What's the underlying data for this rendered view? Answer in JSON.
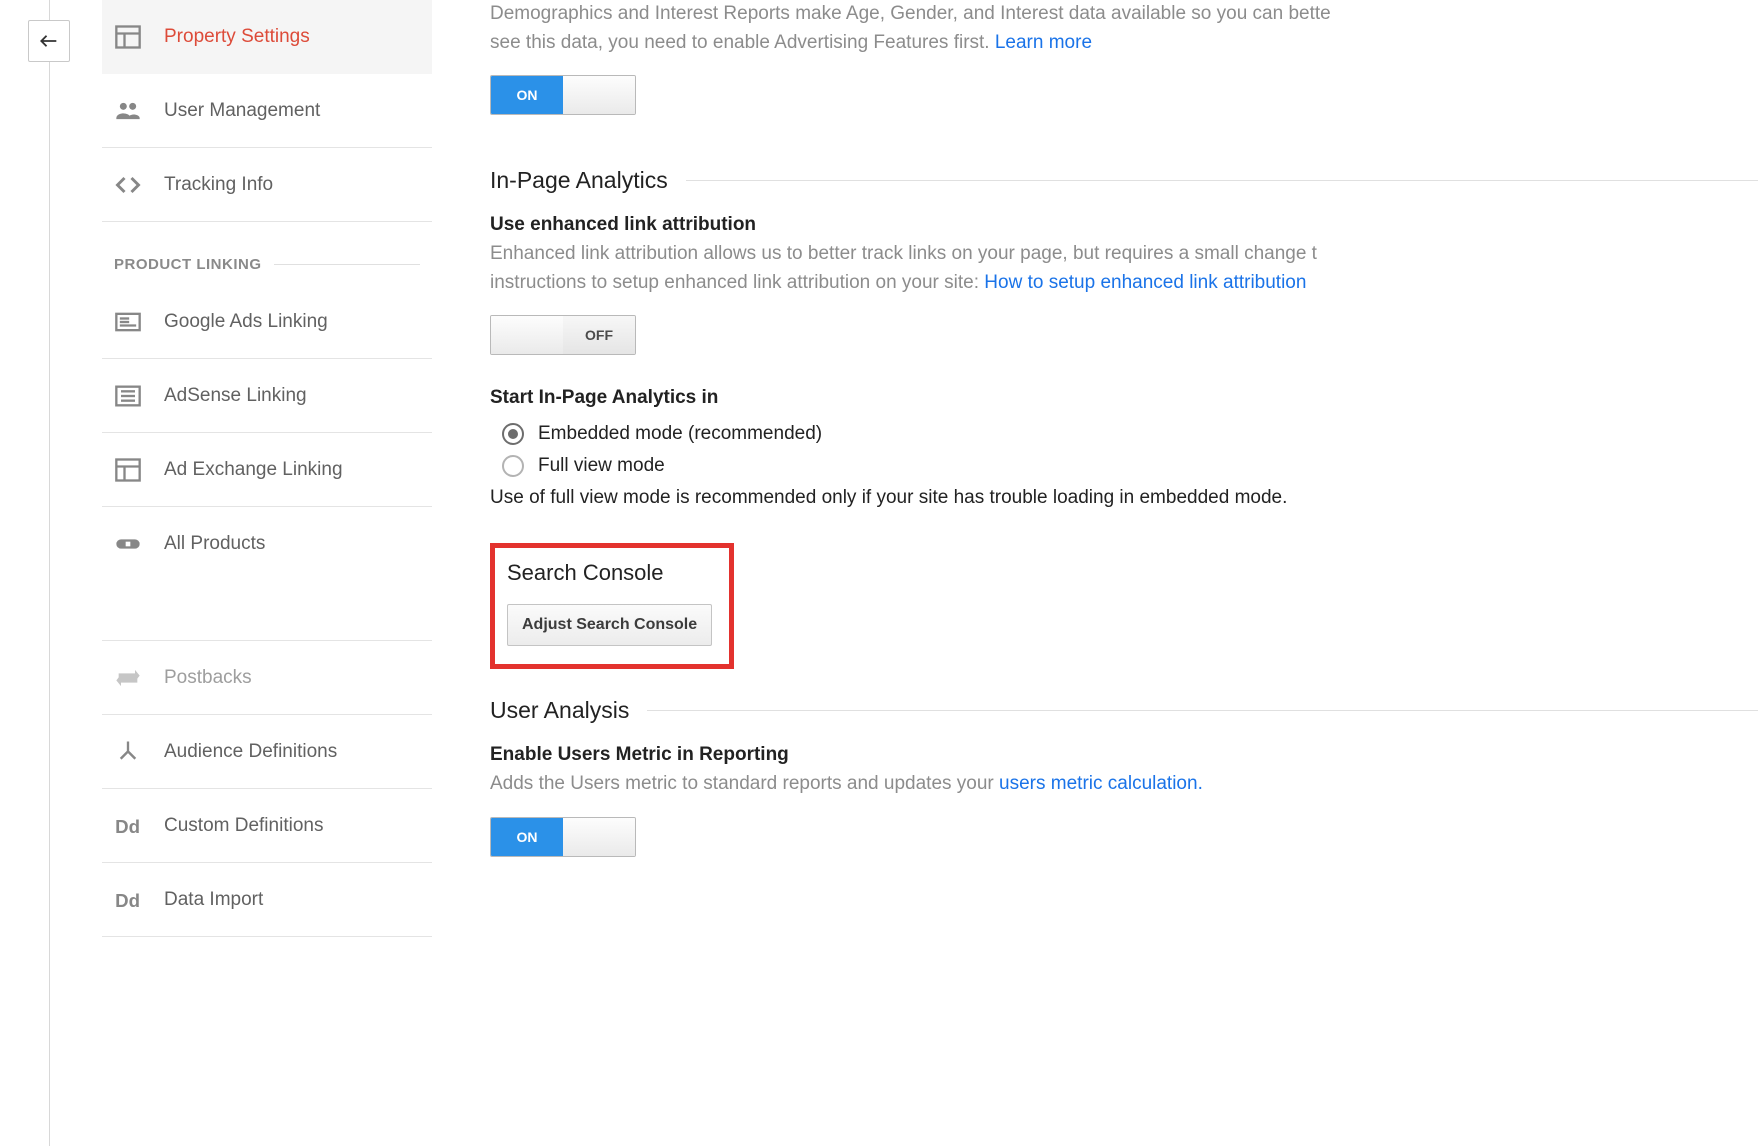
{
  "sidebar": {
    "items": [
      {
        "label": "Property Settings"
      },
      {
        "label": "User Management"
      },
      {
        "label": "Tracking Info"
      }
    ],
    "product_linking_heading": "PRODUCT LINKING",
    "product_items": [
      {
        "label": "Google Ads Linking"
      },
      {
        "label": "AdSense Linking"
      },
      {
        "label": "Ad Exchange Linking"
      },
      {
        "label": "All Products"
      }
    ],
    "bottom_items": [
      {
        "label": "Postbacks"
      },
      {
        "label": "Audience Definitions"
      },
      {
        "label": "Custom Definitions"
      },
      {
        "label": "Data Import"
      }
    ]
  },
  "demographics": {
    "desc_prefix": "Demographics and Interest Reports make Age, Gender, and Interest data available so you can bette",
    "desc_suffix": "see this data, you need to enable Advertising Features first. ",
    "learn_more": "Learn more",
    "toggle_state": "ON"
  },
  "inpage": {
    "section_title": "In-Page Analytics",
    "enhanced_label": "Use enhanced link attribution",
    "enhanced_desc_prefix": "Enhanced link attribution allows us to better track links on your page, but requires a small change t",
    "enhanced_desc_suffix": "instructions to setup enhanced link attribution on your site: ",
    "enhanced_link": "How to setup enhanced link attribution",
    "toggle_state": "OFF",
    "start_label": "Start In-Page Analytics in",
    "radio_embedded": "Embedded mode (recommended)",
    "radio_fullview": "Full view mode",
    "helper_text": "Use of full view mode is recommended only if your site has trouble loading in embedded mode."
  },
  "search_console": {
    "section_title": "Search Console",
    "button_label": "Adjust Search Console"
  },
  "user_analysis": {
    "section_title": "User Analysis",
    "enable_label": "Enable Users Metric in Reporting",
    "desc_prefix": "Adds the Users metric to standard reports and updates your ",
    "desc_link": "users metric calculation.",
    "toggle_state": "ON"
  },
  "toggle_labels": {
    "on": "ON",
    "off": "OFF"
  }
}
